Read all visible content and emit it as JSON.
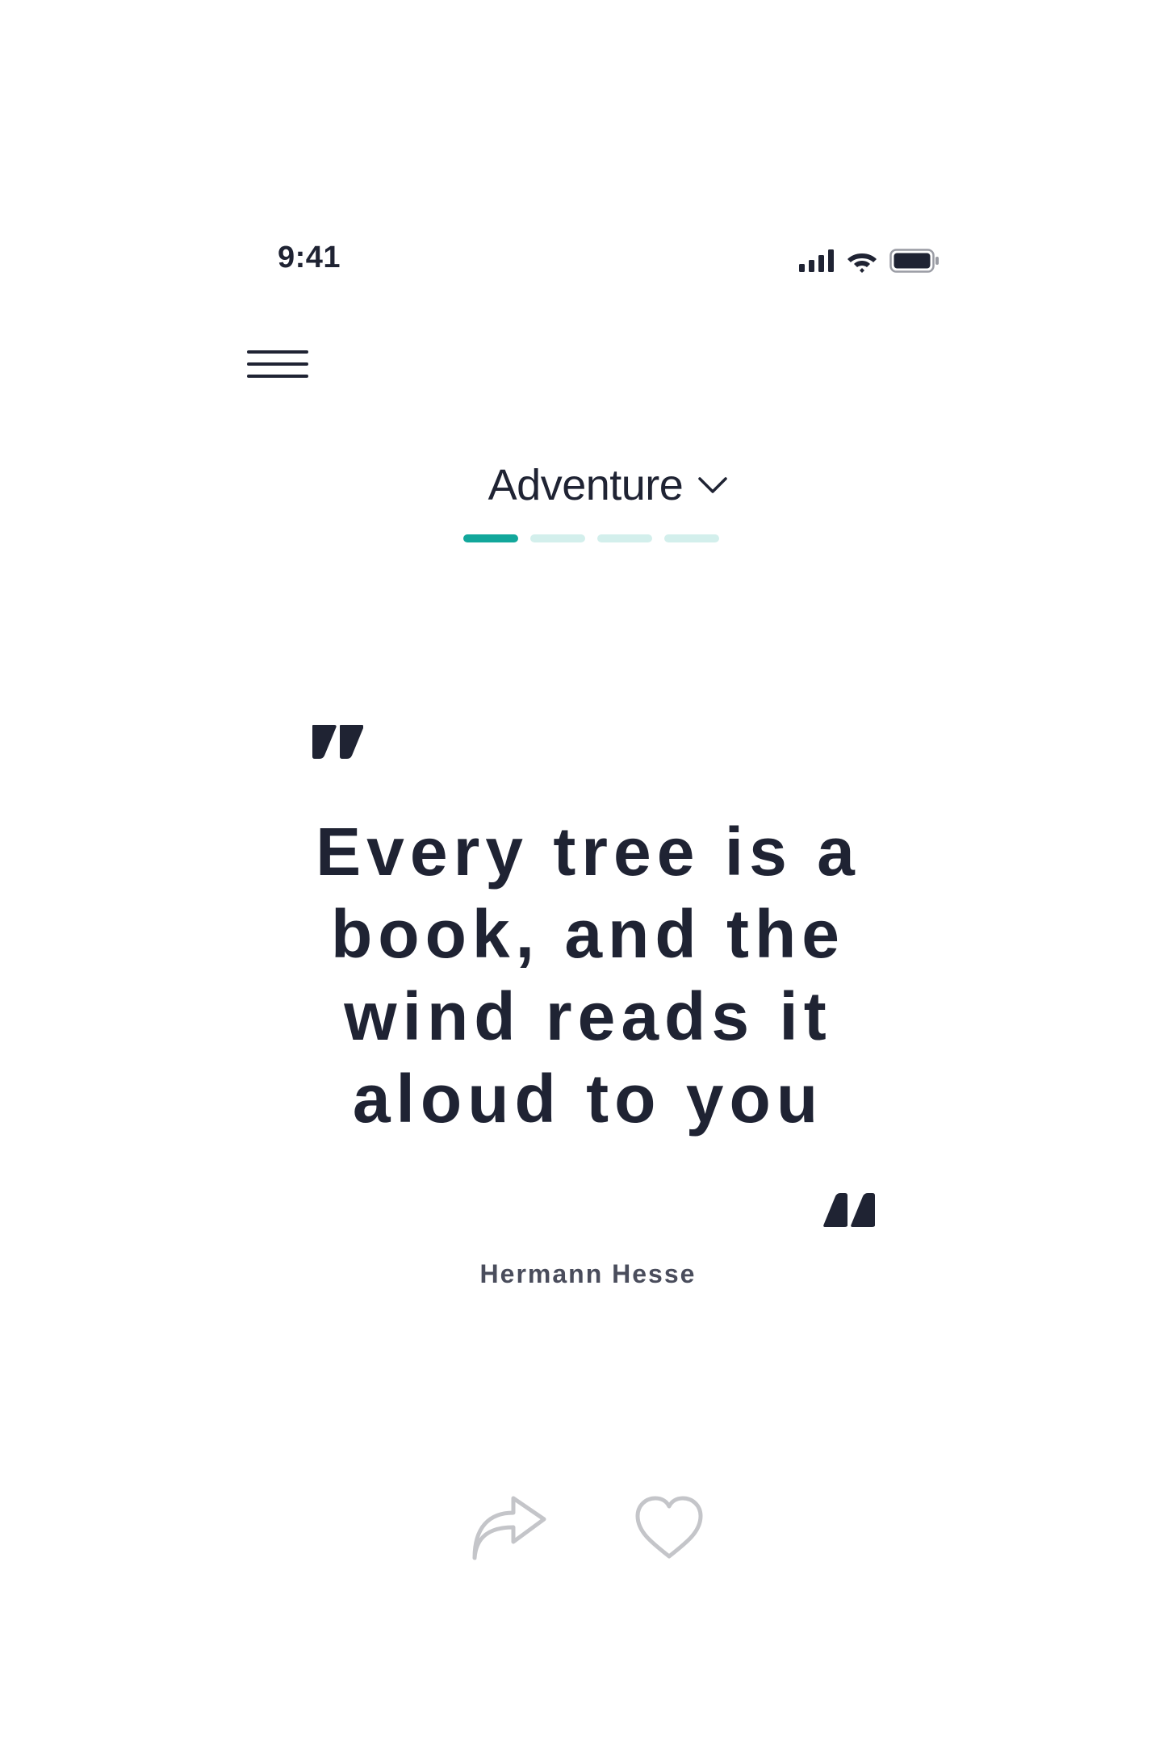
{
  "status_bar": {
    "time": "9:41",
    "icons": [
      "cellular-signal-icon",
      "wifi-icon",
      "battery-icon"
    ]
  },
  "header": {
    "menu_icon": "hamburger-menu-icon"
  },
  "category": {
    "label": "Adventure",
    "dropdown_icon": "chevron-down-icon",
    "pages_total": 4,
    "current_page": 1
  },
  "quote": {
    "lines": [
      "Every tree is a",
      "book, and the",
      "wind reads it",
      "aloud to you"
    ],
    "author": "Hermann Hesse"
  },
  "actions": {
    "share_icon": "share-arrow-icon",
    "like_icon": "heart-icon"
  },
  "colors": {
    "text": "#1f2333",
    "author_text": "#4a4d5c",
    "accent": "#12a79b",
    "accent_light": "#d3efec",
    "icon_muted": "#c4c5c9"
  }
}
